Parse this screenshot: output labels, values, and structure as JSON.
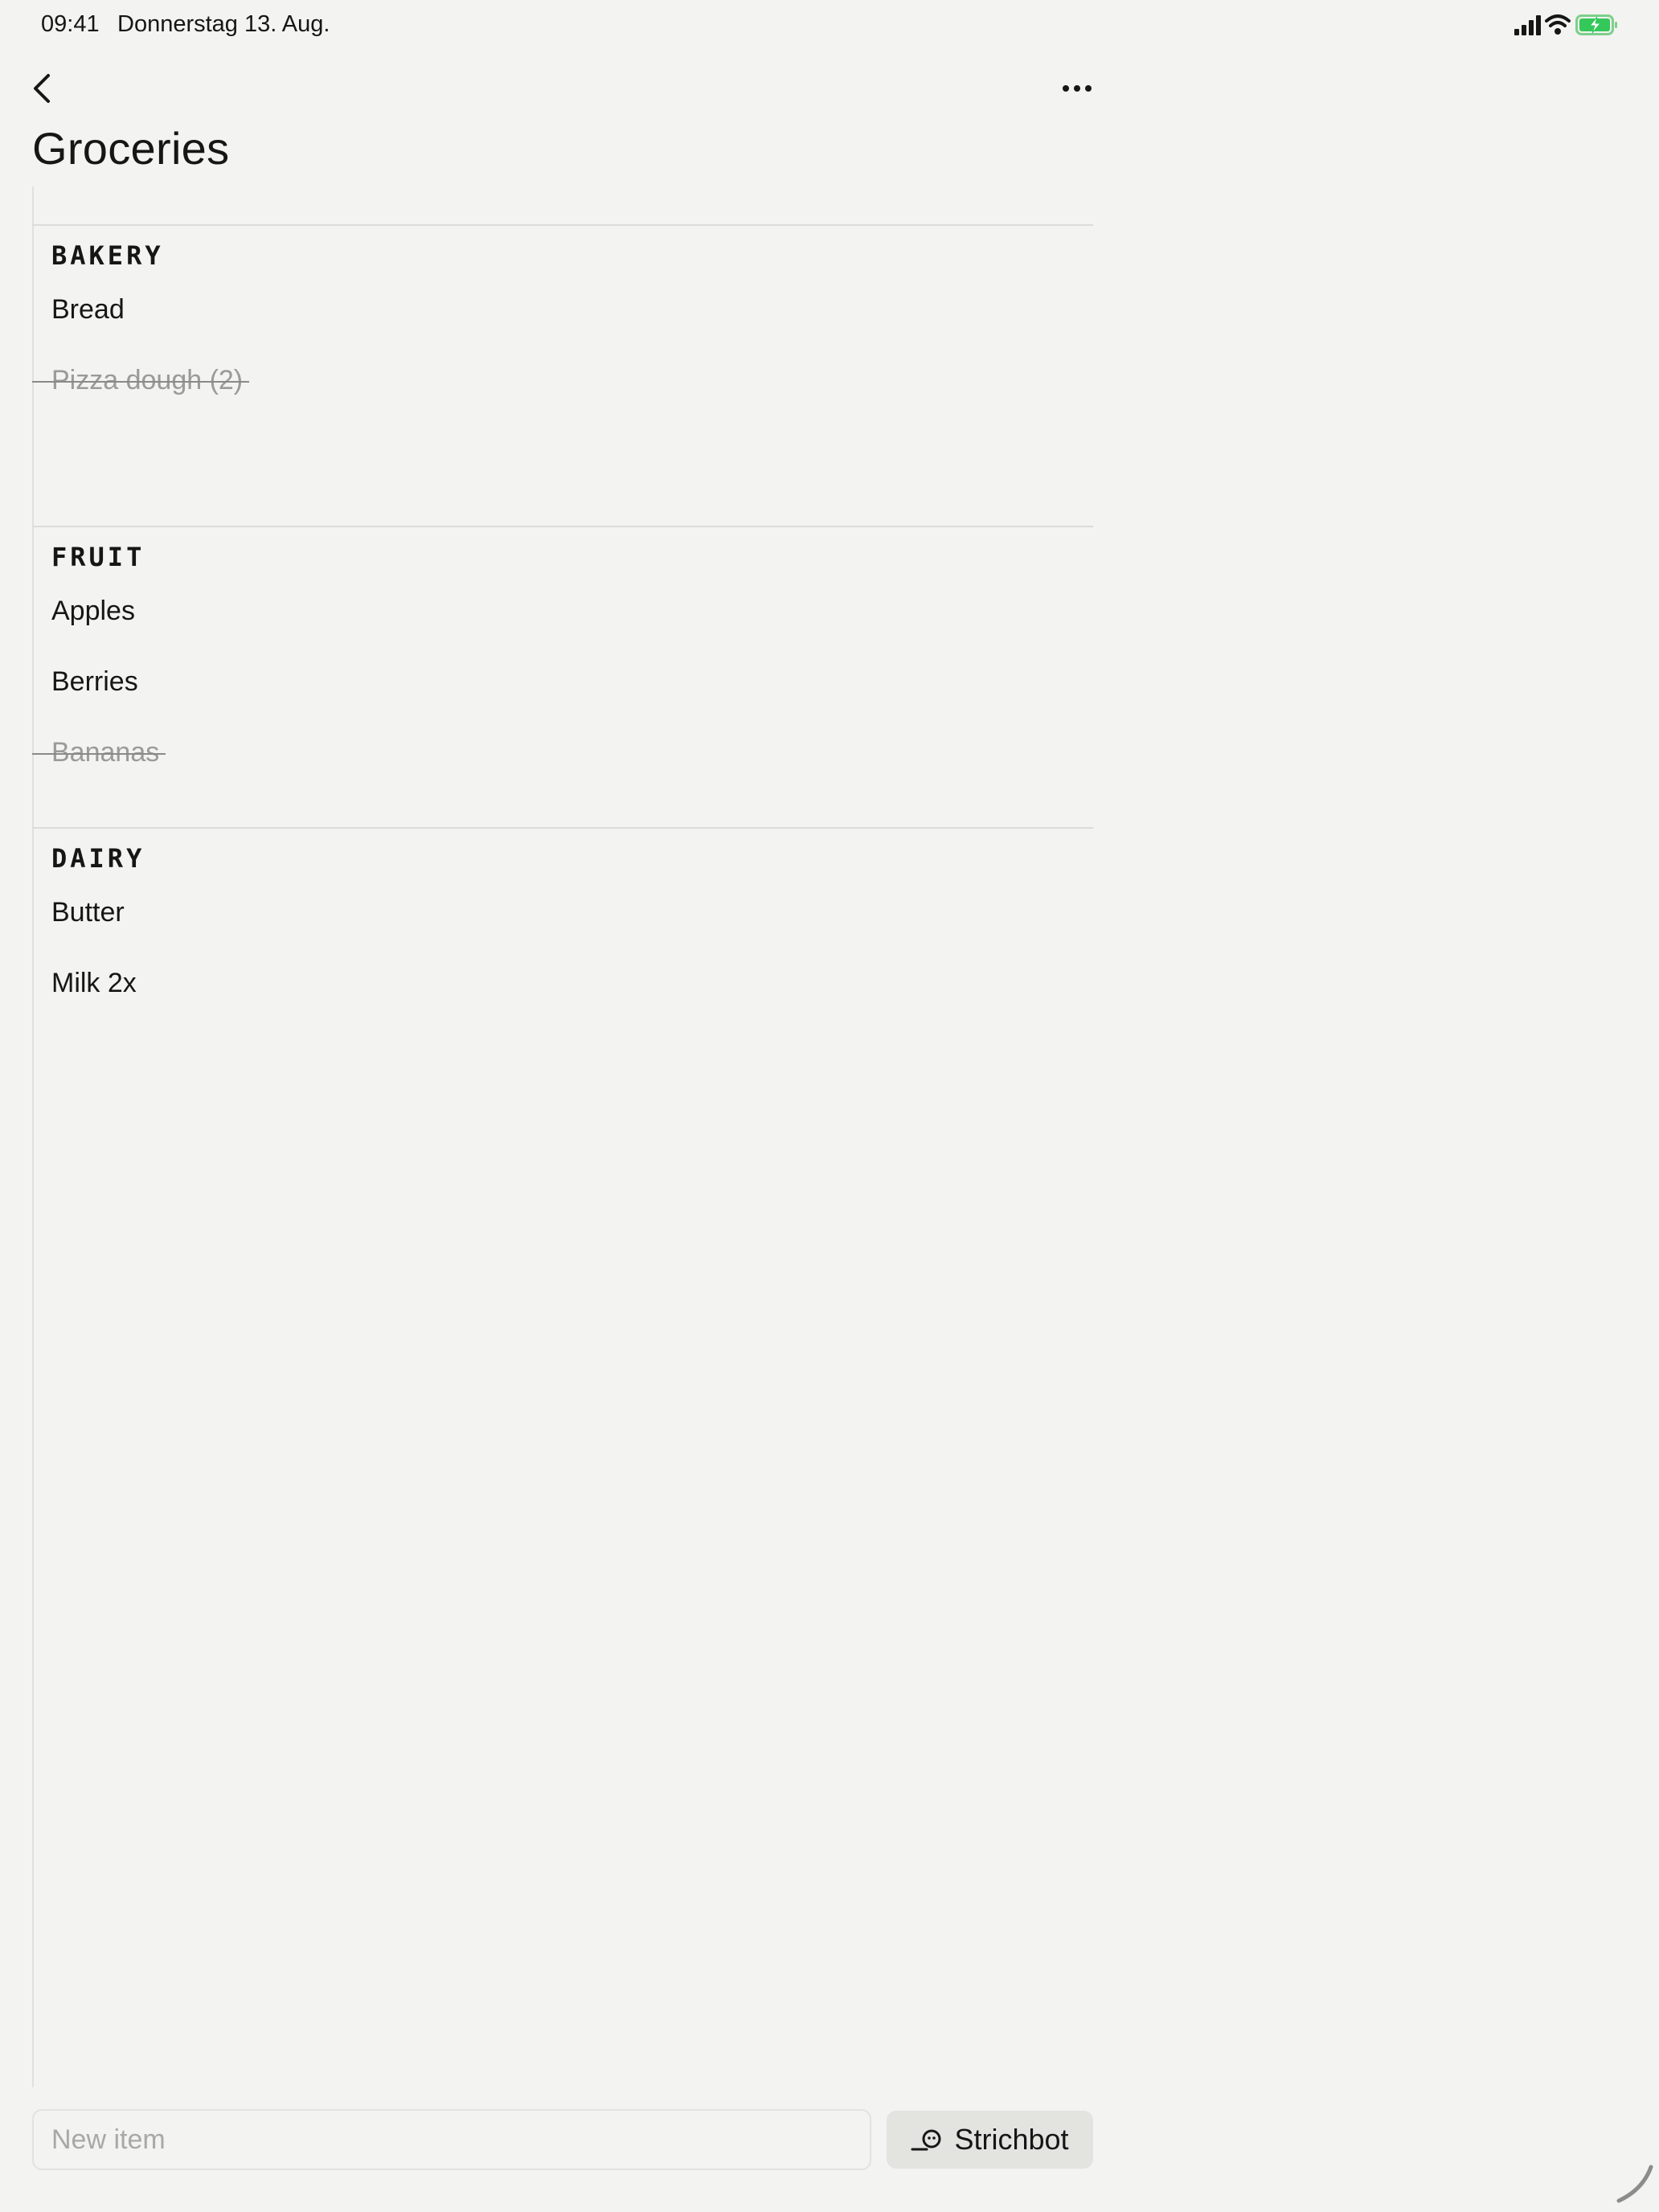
{
  "status_bar": {
    "time": "09:41",
    "date": "Donnerstag 13. Aug.",
    "icons": [
      "signal-icon",
      "wifi-icon",
      "battery-charging-icon"
    ],
    "battery_color": "#34c759"
  },
  "nav": {
    "back_icon": "chevron-left-icon",
    "more_icon": "ellipsis-icon"
  },
  "title": "Groceries",
  "sections": [
    {
      "header": "BAKERY",
      "items": [
        {
          "label": "Bread",
          "done": false
        },
        {
          "label": "Pizza dough (2)",
          "done": true
        }
      ]
    },
    {
      "header": "FRUIT",
      "items": [
        {
          "label": "Apples",
          "done": false
        },
        {
          "label": "Berries",
          "done": false
        },
        {
          "label": "Bananas",
          "done": true
        }
      ]
    },
    {
      "header": "DAIRY",
      "items": [
        {
          "label": "Butter",
          "done": false
        },
        {
          "label": "Milk 2x",
          "done": false
        }
      ]
    }
  ],
  "composer": {
    "placeholder": "New item",
    "value": "",
    "bot_button_label": "Strichbot",
    "bot_icon": "bot-face-icon"
  },
  "colors": {
    "background": "#f3f3f1",
    "text": "#161616",
    "done_text": "#9a9a97",
    "divider": "#dcdcd8"
  }
}
